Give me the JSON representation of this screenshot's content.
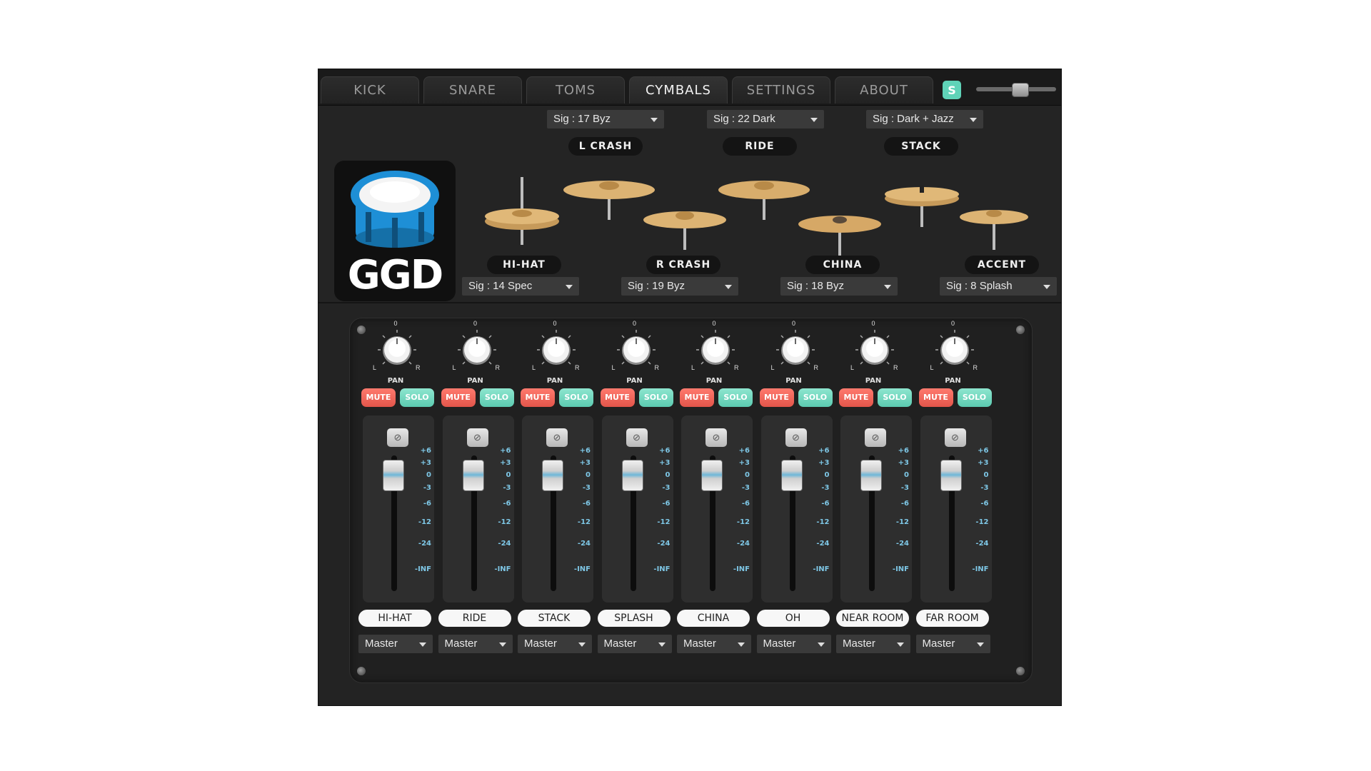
{
  "tabs": [
    {
      "label": "KICK",
      "active": false
    },
    {
      "label": "SNARE",
      "active": false
    },
    {
      "label": "TOMS",
      "active": false
    },
    {
      "label": "CYMBALS",
      "active": true
    },
    {
      "label": "SETTINGS",
      "active": false
    },
    {
      "label": "ABOUT",
      "active": false
    }
  ],
  "header": {
    "s_button": "S",
    "volume_level": 0.55
  },
  "logo": {
    "text": "GGD"
  },
  "cymbals": {
    "top_selects": [
      "Sig : 17 Byz",
      "Sig : 22 Dark",
      "Sig : Dark + Jazz"
    ],
    "top_labels": [
      "L CRASH",
      "RIDE",
      "STACK"
    ],
    "bottom_labels": [
      "HI-HAT",
      "R CRASH",
      "CHINA",
      "ACCENT"
    ],
    "bottom_selects": [
      "Sig : 14 Spec",
      "Sig : 19 Byz",
      "Sig : 18 Byz",
      "Sig : 8 Splash"
    ]
  },
  "mixer": {
    "pan_label": "PAN",
    "knob_center": "0",
    "knob_left": "L",
    "knob_right": "R",
    "mute_label": "MUTE",
    "solo_label": "SOLO",
    "scale": [
      "+6",
      "+3",
      "0",
      "-3",
      "-6",
      "-12",
      "-24",
      "-INF"
    ],
    "channels": [
      {
        "name": "HI-HAT",
        "output": "Master",
        "fader_db": 0
      },
      {
        "name": "RIDE",
        "output": "Master",
        "fader_db": 0
      },
      {
        "name": "STACK",
        "output": "Master",
        "fader_db": 0
      },
      {
        "name": "SPLASH",
        "output": "Master",
        "fader_db": 0
      },
      {
        "name": "CHINA",
        "output": "Master",
        "fader_db": 0
      },
      {
        "name": "OH",
        "output": "Master",
        "fader_db": 0
      },
      {
        "name": "NEAR ROOM",
        "output": "Master",
        "fader_db": 0
      },
      {
        "name": "FAR ROOM",
        "output": "Master",
        "fader_db": 0
      }
    ]
  },
  "colors": {
    "mute": "#e2554a",
    "solo": "#5bcab0",
    "accent": "#5fd3b8",
    "scale": "#7ec7e6",
    "drum_blue": "#1e8fd6"
  }
}
